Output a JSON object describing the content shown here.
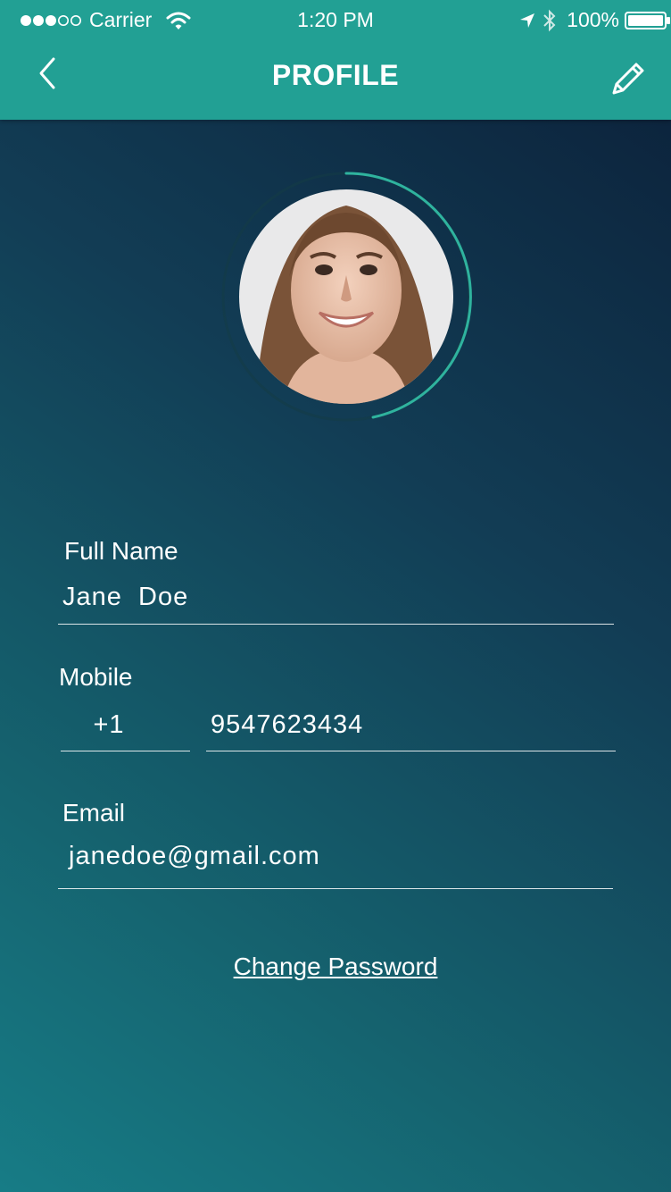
{
  "status_bar": {
    "carrier": "Carrier",
    "time": "1:20 PM",
    "battery_percent": "100%",
    "battery_level": 1.0,
    "signal_bars_filled": 3,
    "signal_bars_total": 5,
    "icons": [
      "signal-dots-icon",
      "wifi-icon",
      "location-arrow-icon",
      "bluetooth-icon",
      "battery-icon"
    ]
  },
  "nav": {
    "title": "PROFILE",
    "back_icon": "chevron-left-icon",
    "edit_icon": "pencil-icon"
  },
  "profile": {
    "avatar": "profile-photo",
    "progress_ring_accent": "#2fb39e"
  },
  "form": {
    "full_name": {
      "label": "Full Name",
      "value": "Jane  Doe"
    },
    "mobile": {
      "label": "Mobile",
      "country_code": "+1",
      "number": "9547623434"
    },
    "email": {
      "label": "Email",
      "value": "janedoe@gmail.com"
    }
  },
  "actions": {
    "change_password": "Change Password"
  },
  "colors": {
    "header": "#22a094",
    "background_top": "#0b1f38",
    "background_bottom": "#177c86"
  }
}
